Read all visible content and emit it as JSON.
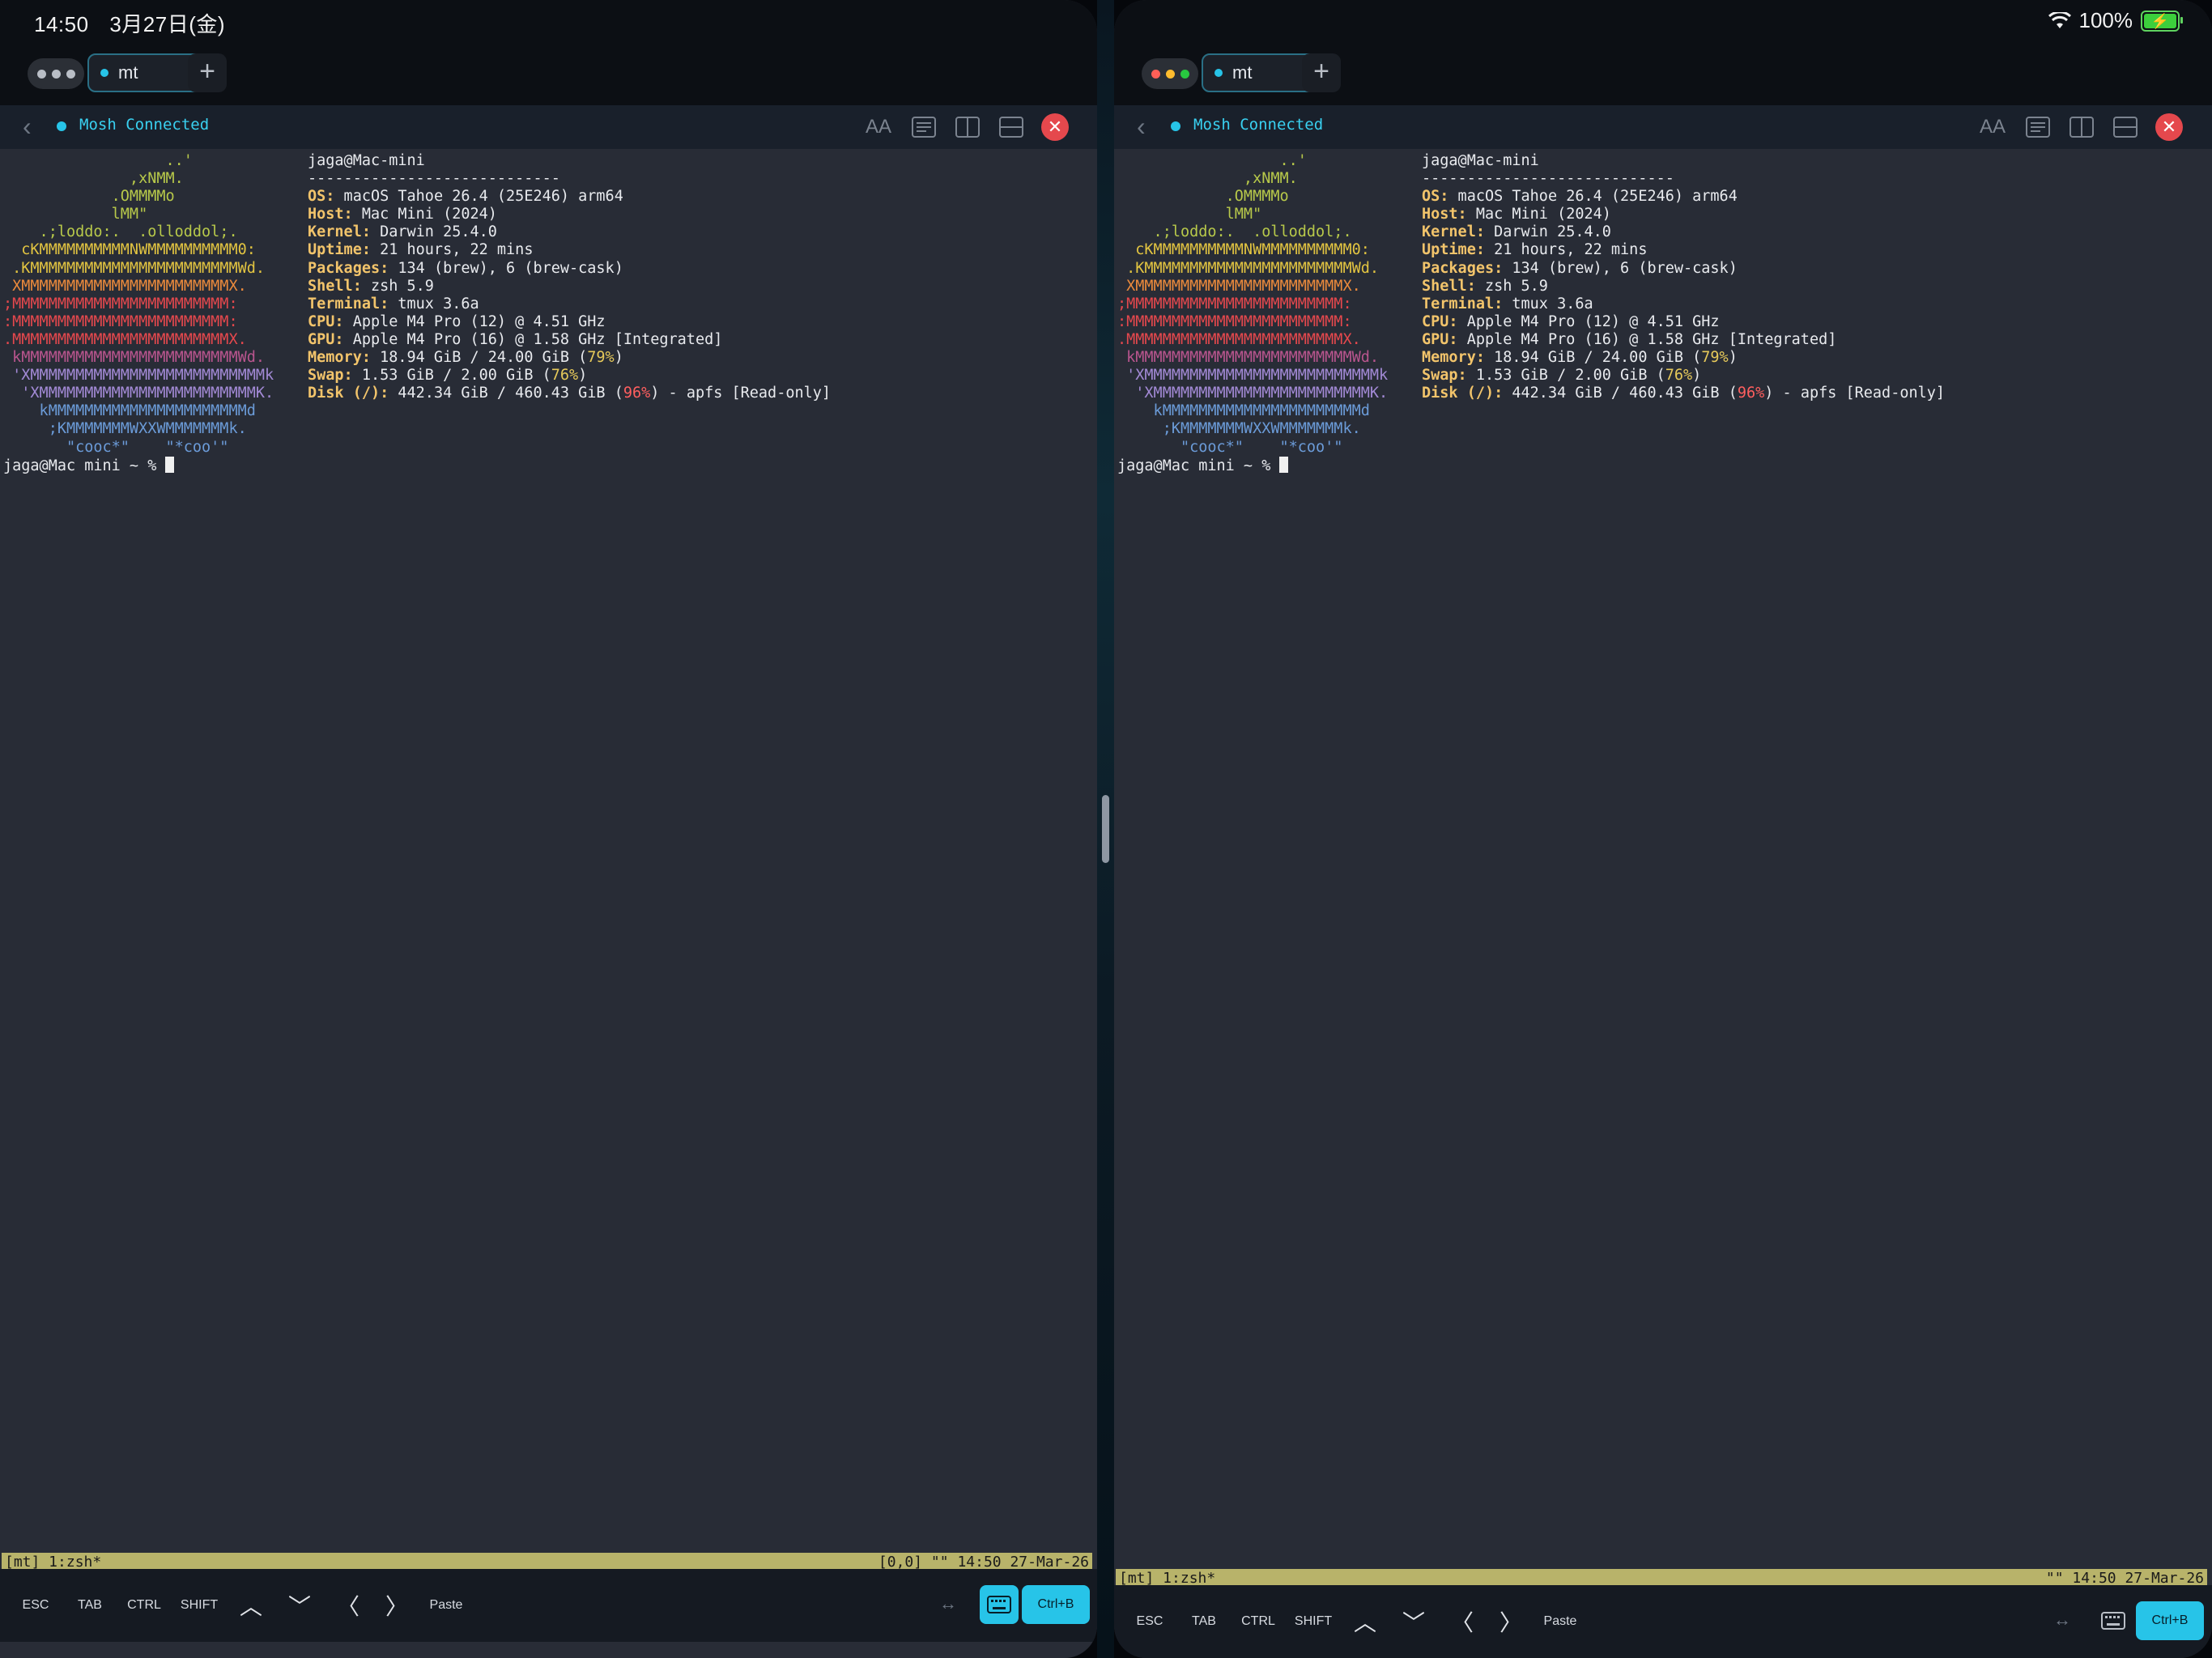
{
  "status": {
    "time": "14:50",
    "date": "3月27日(金)",
    "battery": "100%",
    "wifi_icon": "wifi-icon",
    "battery_icon": "battery-charging-icon"
  },
  "colors": {
    "accent": "#27c4e8",
    "pane_bg": "#282c36",
    "tmux_bar": "#b8b36a",
    "close_red": "#e5484d",
    "label_yellow": "#f2c46b"
  },
  "tabs": [
    {
      "label": "mt",
      "close": "×"
    }
  ],
  "tab_add": "+",
  "toolbar": {
    "connection": "Mosh Connected",
    "font_size_label": "AA",
    "close": "✕"
  },
  "terminal": {
    "logo_lines": [
      "                  ..'",
      "              ,xNMM.",
      "            .OMMMMo",
      "            lMM\"",
      "    .;loddo:.  .olloddol;.",
      "  cKMMMMMMMMMMNWMMMMMMMMMM0:",
      " .KMMMMMMMMMMMMMMMMMMMMMMMWd.",
      " XMMMMMMMMMMMMMMMMMMMMMMMX.",
      ";MMMMMMMMMMMMMMMMMMMMMMMM:",
      ":MMMMMMMMMMMMMMMMMMMMMMMM:",
      ".MMMMMMMMMMMMMMMMMMMMMMMMX.",
      " kMMMMMMMMMMMMMMMMMMMMMMMMWd.",
      " 'XMMMMMMMMMMMMMMMMMMMMMMMMMMk",
      "  'XMMMMMMMMMMMMMMMMMMMMMMMMK.",
      "    kMMMMMMMMMMMMMMMMMMMMMMd",
      "     ;KMMMMMMMWXXWMMMMMMMk.",
      "       \"cooc*\"    \"*coo'\""
    ],
    "user_host": "jaga@Mac-mini",
    "separator": "----------------------------",
    "info": [
      {
        "key": "OS:",
        "value": " macOS Tahoe 26.4 (25E246) arm64"
      },
      {
        "key": "Host:",
        "value": " Mac Mini (2024)"
      },
      {
        "key": "Kernel:",
        "value": " Darwin 25.4.0"
      },
      {
        "key": "Uptime:",
        "value": " 21 hours, 22 mins"
      },
      {
        "key": "Packages:",
        "value": " 134 (brew), 6 (brew-cask)"
      },
      {
        "key": "Shell:",
        "value": " zsh 5.9"
      },
      {
        "key": "Terminal:",
        "value": " tmux 3.6a"
      },
      {
        "key": "CPU:",
        "value": " Apple M4 Pro (12) @ 4.51 GHz"
      },
      {
        "key": "GPU:",
        "value": " Apple M4 Pro (16) @ 1.58 GHz [Integrated]"
      }
    ],
    "memory": {
      "key": "Memory:",
      "pre": " 18.94 GiB / 24.00 GiB (",
      "pct": "79%",
      "post": ")"
    },
    "swap": {
      "key": "Swap:",
      "pre": " 1.53 GiB / 2.00 GiB (",
      "pct": "76%",
      "post": ")"
    },
    "disk": {
      "key": "Disk (/):",
      "pre": " 442.34 GiB / 460.43 GiB (",
      "pct": "96%",
      "post": ") - apfs [Read-only]"
    },
    "prompt": "jaga@Mac mini ~ % "
  },
  "tmux_left": {
    "left": "[mt] 1:zsh*",
    "right": "[0,0] \"\" 14:50 27-Mar-26"
  },
  "tmux_right": {
    "left": "[mt] 1:zsh*",
    "right": "\"\" 14:50 27-Mar-26"
  },
  "keys": {
    "esc": "ESC",
    "tab": "TAB",
    "ctrl": "CTRL",
    "shift": "SHIFT",
    "up": "︿",
    "down": "﹀",
    "left": "〈",
    "right": "〉",
    "paste": "Paste",
    "swap": "↔",
    "ctrl_b": "Ctrl+B"
  }
}
